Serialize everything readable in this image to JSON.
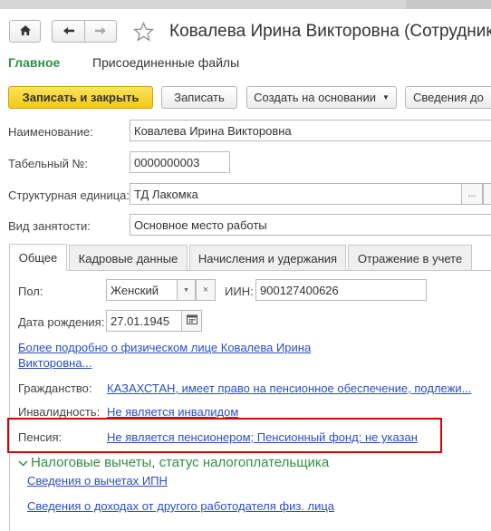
{
  "toolbar": {
    "home_icon": "home-icon",
    "back_icon": "arrow-left-icon",
    "forward_icon": "arrow-right-icon",
    "favorite_icon": "star-icon",
    "title": "Ковалева Ирина Викторовна (Сотрудник)"
  },
  "sections": {
    "main": "Главное",
    "files": "Присоединенные файлы"
  },
  "actions": {
    "save_close": "Записать и закрыть",
    "save": "Записать",
    "create_based": "Создать на основании",
    "info": "Сведения до"
  },
  "form": {
    "name_label": "Наименование:",
    "name_value": "Ковалева Ирина Викторовна",
    "tabnum_label": "Табельный №:",
    "tabnum_value": "0000000003",
    "unit_label": "Структурная единица:",
    "unit_value": "ТД Лакомка",
    "unit_more": "...",
    "employment_label": "Вид занятости:",
    "employment_value": "Основное место работы"
  },
  "tabs": [
    {
      "label": "Общее"
    },
    {
      "label": "Кадровые данные"
    },
    {
      "label": "Начисления и удержания"
    },
    {
      "label": "Отражение в учете"
    }
  ],
  "general": {
    "gender_label": "Пол:",
    "gender_value": "Женский",
    "clear": "×",
    "iin_label": "ИИН:",
    "iin_value": "900127400626",
    "birth_label": "Дата рождения:",
    "birth_value": "27.01.1945",
    "person_link": "Более подробно о физическом лице Ковалева Ирина Викторовна...",
    "citizenship_label": "Гражданство:",
    "citizenship_value": "КАЗАХСТАН, имеет право на пенсионное обеспечение, подлежи...",
    "disability_label": "Инвалидность:",
    "disability_value": "Не является инвалидом",
    "pension_label": "Пенсия:",
    "pension_value": "Не является пенсионером; Пенсионный фонд: не указан",
    "tax_group_title": "Налоговые вычеты, статус налогоплательщика",
    "ipn_link": "Сведения о вычетах ИПН",
    "income_link": "Сведения о доходах от другого работодателя физ. лица"
  },
  "colors": {
    "accent_green": "#2f8f46",
    "link_blue": "#2a4ec4",
    "primary_yellow": "#f2c814",
    "highlight_red": "#e30000"
  }
}
